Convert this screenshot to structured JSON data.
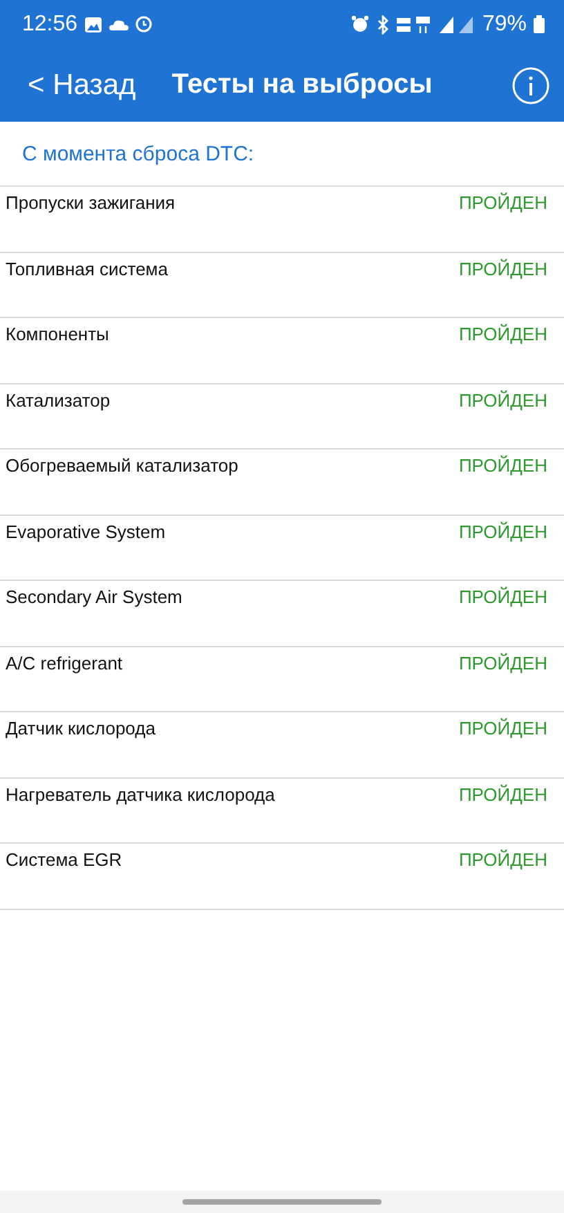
{
  "status_bar": {
    "time": "12:56",
    "battery": "79%"
  },
  "header": {
    "back": "< Назад",
    "title": "Тесты на выбросы"
  },
  "section": "С момента сброса DTC:",
  "tests": [
    {
      "name": "Пропуски зажигания",
      "result": "ПРОЙДЕН",
      "passed": true
    },
    {
      "name": "Топливная система",
      "result": "ПРОЙДЕН",
      "passed": true
    },
    {
      "name": "Компоненты",
      "result": "ПРОЙДЕН",
      "passed": true
    },
    {
      "name": "Катализатор",
      "result": "ПРОЙДЕН",
      "passed": true
    },
    {
      "name": "Обогреваемый катализатор",
      "result": "ПРОЙДЕН",
      "passed": true
    },
    {
      "name": "Evaporative System",
      "result": "ПРОЙДЕН",
      "passed": true
    },
    {
      "name": "Secondary Air System",
      "result": "ПРОЙДЕН",
      "passed": true
    },
    {
      "name": "A/C refrigerant",
      "result": "ПРОЙДЕН",
      "passed": true
    },
    {
      "name": "Датчик кислорода",
      "result": "ПРОЙДЕН",
      "passed": true
    },
    {
      "name": "Нагреватель датчика кислорода",
      "result": "ПРОЙДЕН",
      "passed": true
    },
    {
      "name": "Система EGR",
      "result": "ПРОЙДЕН",
      "passed": true
    }
  ]
}
